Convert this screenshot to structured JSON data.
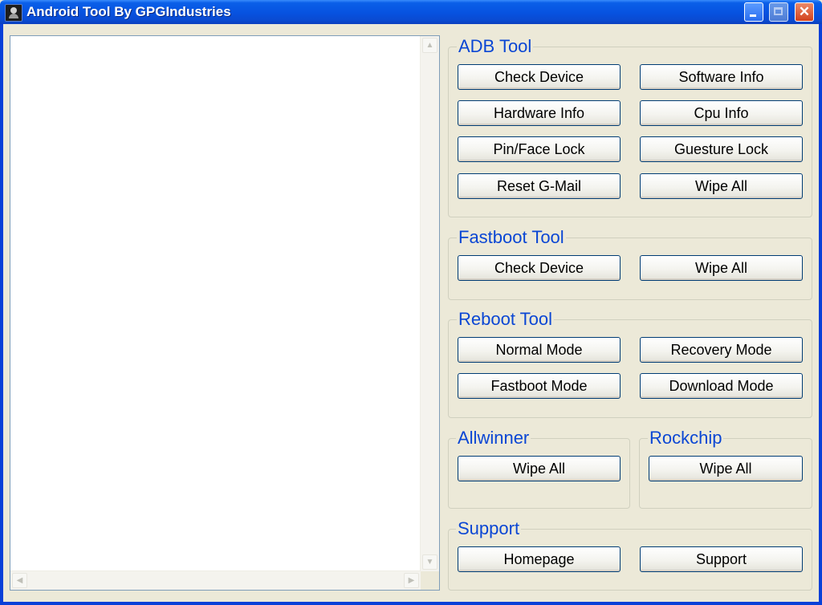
{
  "window": {
    "title": "Android Tool By GPGIndustries",
    "close_glyph": "✕"
  },
  "groups": {
    "adb": {
      "title": "ADB Tool",
      "buttons": [
        "Check Device",
        "Software Info",
        "Hardware Info",
        "Cpu Info",
        "Pin/Face Lock",
        "Guesture Lock",
        "Reset G-Mail",
        "Wipe All"
      ]
    },
    "fastboot": {
      "title": "Fastboot Tool",
      "buttons": [
        "Check Device",
        "Wipe All"
      ]
    },
    "reboot": {
      "title": "Reboot Tool",
      "buttons": [
        "Normal Mode",
        "Recovery Mode",
        "Fastboot Mode",
        "Download Mode"
      ]
    },
    "allwinner": {
      "title": "Allwinner",
      "buttons": [
        "Wipe All"
      ]
    },
    "rockchip": {
      "title": "Rockchip",
      "buttons": [
        "Wipe All"
      ]
    },
    "support": {
      "title": "Support",
      "buttons": [
        "Homepage",
        "Support"
      ]
    }
  },
  "output": {
    "text": ""
  }
}
